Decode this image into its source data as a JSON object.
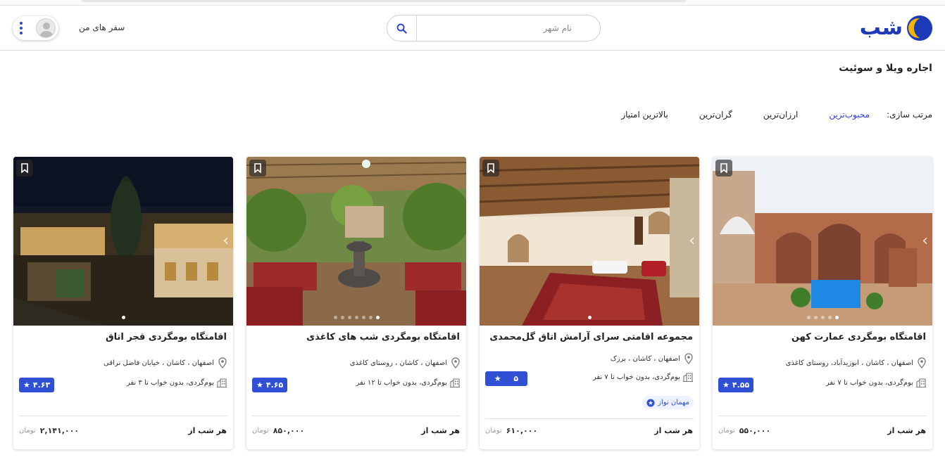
{
  "header": {
    "logo_text": "شب",
    "search": {
      "placeholder": "نام شهر",
      "value": ""
    },
    "my_trips": "سفر های من",
    "colors": {
      "brand_blue": "#1d3bb8",
      "brand_yellow": "#f5b400",
      "accent": "#2b3fd6"
    }
  },
  "page": {
    "title": "اجاره ویلا و سوئیت"
  },
  "sort": {
    "label": "مرتب سازی:",
    "options": [
      {
        "label": "محبوب‌ترین",
        "active": true
      },
      {
        "label": "ارزان‌ترین",
        "active": false
      },
      {
        "label": "گران‌ترین",
        "active": false
      },
      {
        "label": "بالاترین امتیاز",
        "active": false
      }
    ]
  },
  "cards": [
    {
      "title": "اقامتگاه بومگردی عمارت کهن",
      "location": "اصفهان ، کاشان ، ابوزیدآباد، روستای کاغذی",
      "type": "بوم‌گردی، بدون خواب تا ۷ نفر",
      "rating": "۴.۵۵",
      "host_badge": "",
      "per_night": "هر شب از",
      "price": "۵۵۰,۰۰۰",
      "currency": "تومان",
      "image_dots": 5,
      "active_dot": 4
    },
    {
      "title": "مجموعه اقامتی سرای آرامش اتاق گل‌محمدی",
      "location": "اصفهان ، کاشان ، برزک",
      "type": "بوم‌گردی، بدون خواب تا ۷ نفر",
      "rating": "۵",
      "host_badge": "مهمان نواز",
      "per_night": "هر شب از",
      "price": "۶۱۰,۰۰۰",
      "currency": "تومان",
      "image_dots": 1,
      "active_dot": 0
    },
    {
      "title": "اقامتگاه بومگردی شب های کاغذی",
      "location": "اصفهان ، کاشان ، روستای کاغذی",
      "type": "بوم‌گردی، بدون خواب تا ۱۲ نفر",
      "rating": "۴.۶۵",
      "host_badge": "",
      "per_night": "هر شب از",
      "price": "۸۵۰,۰۰۰",
      "currency": "تومان",
      "image_dots": 7,
      "active_dot": 6
    },
    {
      "title": "اقامتگاه بومگردی قجر اتاق",
      "location": "اصفهان ، کاشان ، خیابان فاضل نراقی",
      "type": "بوم‌گردی، بدون خواب تا ۳ نفر",
      "rating": "۴.۶۳",
      "host_badge": "",
      "per_night": "هر شب از",
      "price": "۲,۱۴۱,۰۰۰",
      "currency": "تومان",
      "image_dots": 1,
      "active_dot": 0
    }
  ]
}
